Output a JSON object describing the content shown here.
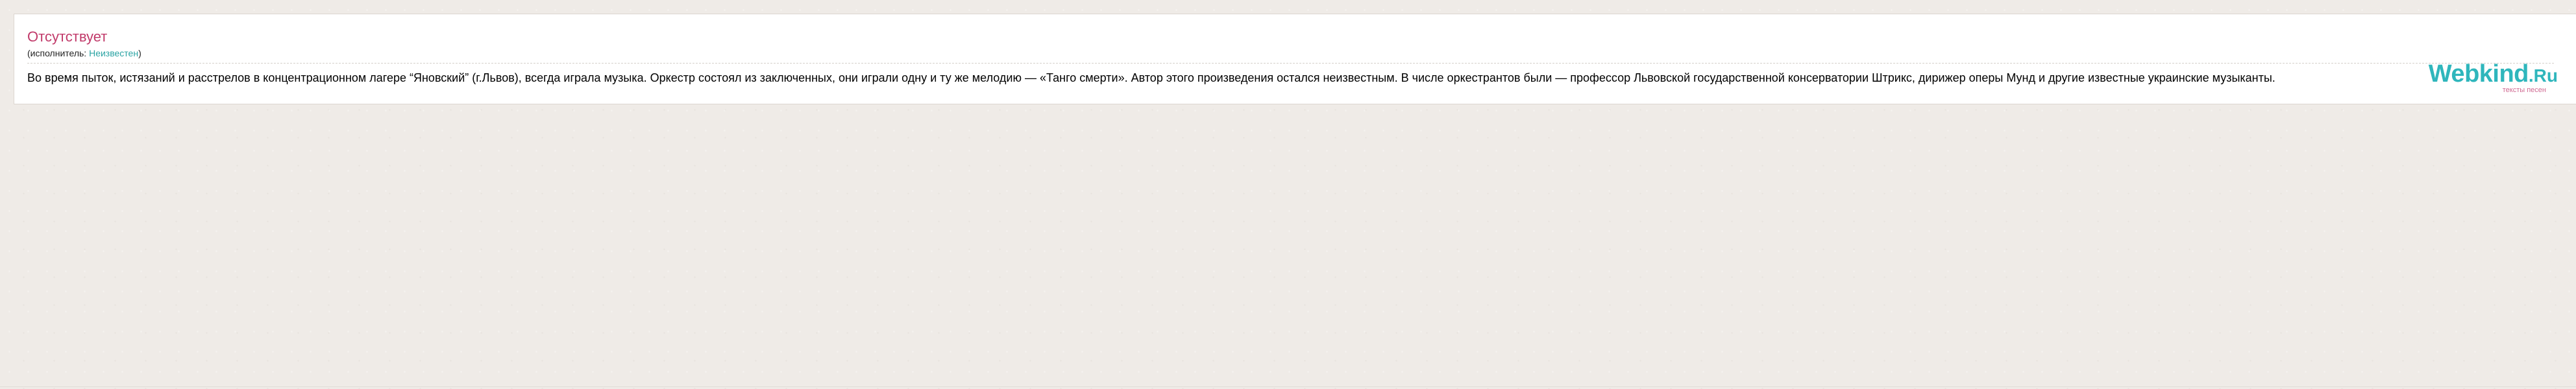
{
  "song": {
    "title": "Отсутствует",
    "performer_prefix": "(исполнитель: ",
    "performer_name": "Неизвестен",
    "performer_suffix": ")",
    "lyrics": "Во время пыток, истязаний и расстрелов в концентрационном лагере “Яновский” (г.Львов), всегда играла музыка. Оркестр состоял из заключенных, они играли одну и ту же мелодию — «Танго смерти». Автор этого произведения остался неизвестным. В числе оркестрантов были — профессор Львовской государственной консерватории Штрикс, дирижер оперы Мунд и другие известные украинские музыканты."
  },
  "logo": {
    "main": "Webkind",
    "tld": ".Ru",
    "tagline": "тексты песен"
  },
  "colors": {
    "title": "#c13a6a",
    "link": "#2aa3a3",
    "logo": "#2fb6bc",
    "tagline": "#d06a92",
    "background": "#efebe7"
  }
}
